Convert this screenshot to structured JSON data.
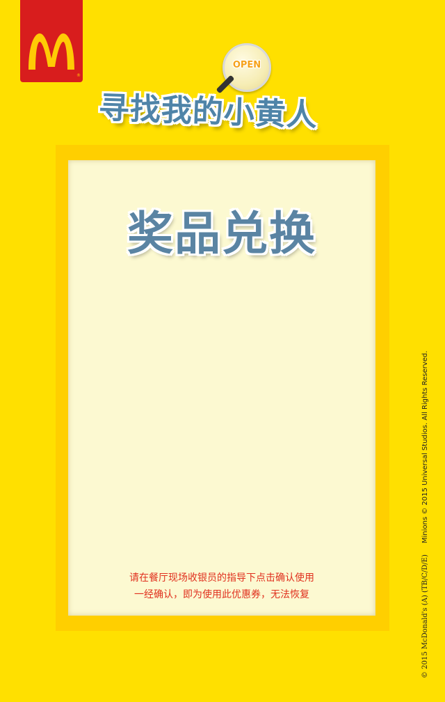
{
  "brand": {
    "logo_letter": "M",
    "registered_mark": "®",
    "tag_color": "#d81d1d",
    "arch_color": "#ffcb05"
  },
  "campaign": {
    "title": "寻找我的小黄人",
    "magnifier_label": "OPEN"
  },
  "coupon": {
    "title": "奖品兑换",
    "notice_lines": [
      "请在餐厅现场收银员的指导下点击确认使用",
      "一经确认，即为使用此优惠券，无法恢复"
    ]
  },
  "copyright": {
    "mcdonalds": "© 2015 McDonald's (A) (TB/C/D/E)",
    "universal": "Minions © 2015 Universal Studios. All Rights Reserved."
  },
  "colors": {
    "background": "#ffe000",
    "frame": "#ffcf00",
    "card": "#fcf9d1",
    "title_blue": "#5a84a3",
    "notice_red": "#e0301e"
  }
}
